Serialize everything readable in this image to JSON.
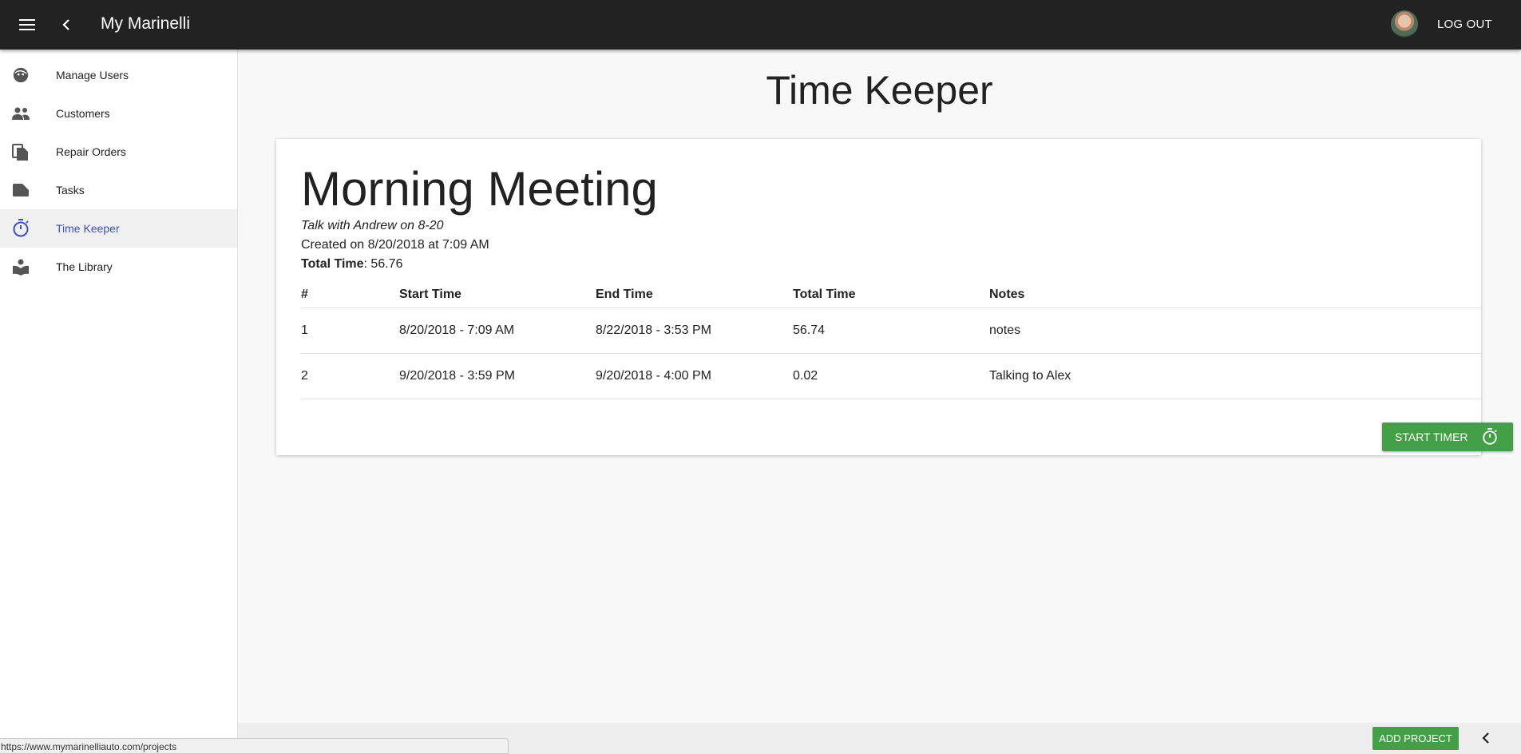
{
  "header": {
    "app_title": "My Marinelli",
    "menu_icon": "menu-icon",
    "back_icon": "chevron-left-icon",
    "avatar": "user-avatar",
    "logout_label": "LOG OUT"
  },
  "sidebar": {
    "items": [
      {
        "label": "Manage Users",
        "icon": "face-icon",
        "active": false
      },
      {
        "label": "Customers",
        "icon": "people-icon",
        "active": false
      },
      {
        "label": "Repair Orders",
        "icon": "file-copy-icon",
        "active": false
      },
      {
        "label": "Tasks",
        "icon": "label-icon",
        "active": false
      },
      {
        "label": "Time Keeper",
        "icon": "timer-icon",
        "active": true
      },
      {
        "label": "The Library",
        "icon": "book-icon",
        "active": false
      }
    ]
  },
  "main": {
    "page_title": "Time Keeper",
    "task": {
      "name": "Morning Meeting",
      "description": "Talk with Andrew on 8-20",
      "created": "Created on 8/20/2018 at 7:09 AM",
      "total_time_label": "Total Time",
      "total_time_value": ": 56.76"
    },
    "table": {
      "columns": [
        "#",
        "Start Time",
        "End Time",
        "Total Time",
        "Notes"
      ],
      "rows": [
        [
          "1",
          "8/20/2018  - 7:09 AM",
          "8/22/2018  - 3:53 PM",
          "56.74",
          "notes"
        ],
        [
          "2",
          "9/20/2018  - 3:59 PM",
          "9/20/2018  - 4:00 PM",
          "0.02",
          "Talking to Alex"
        ]
      ]
    },
    "start_timer_label": "START TIMER"
  },
  "footer": {
    "add_project_label": "ADD PROJECT",
    "collapse_icon": "chevron-left-icon"
  },
  "status_url": "https://www.mymarinelliauto.com/projects",
  "colors": {
    "appbar": "#222222",
    "accent_active": "#3f51b5",
    "button_green": "#43a047"
  }
}
